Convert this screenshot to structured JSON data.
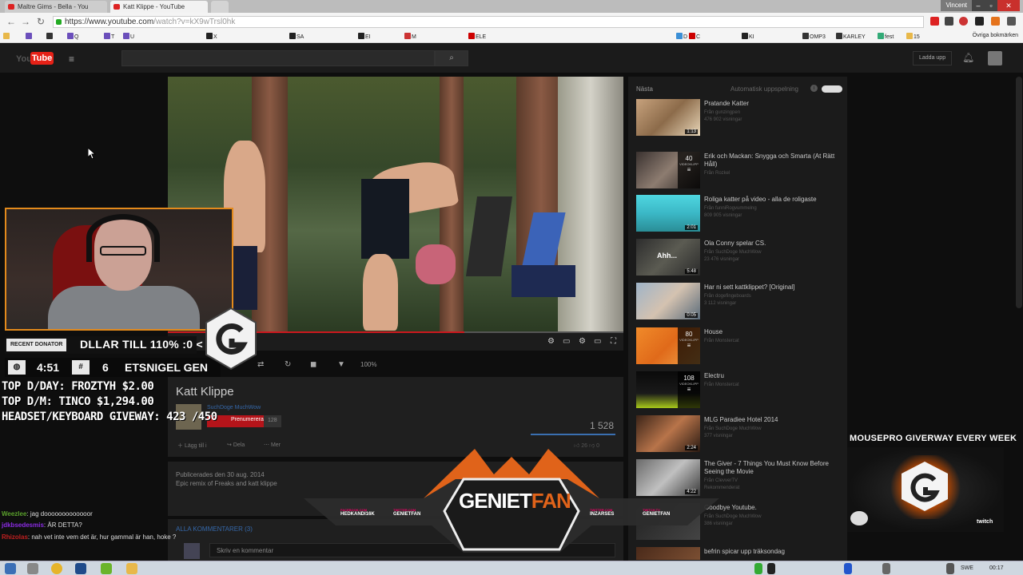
{
  "browser": {
    "tabs": [
      {
        "label": "Maltre Gims - Bella - You"
      },
      {
        "label": "Katt Klippe - YouTube"
      }
    ],
    "user_label": "Vincent",
    "url_host": "https://www.youtube.com",
    "url_rest": "/watch?v=kX9wTrsl0hk",
    "bookmarks": [
      {
        "label": "Q"
      },
      {
        "label": "T"
      },
      {
        "label": "U"
      },
      {
        "label": "X"
      },
      {
        "label": "SA"
      },
      {
        "label": "EI"
      },
      {
        "label": "M"
      },
      {
        "label": "ELE"
      },
      {
        "label": "D"
      },
      {
        "label": "C"
      },
      {
        "label": "KI"
      },
      {
        "label": "OMP3"
      },
      {
        "label": "KARLEY"
      },
      {
        "label": "fest"
      },
      {
        "label": "15"
      }
    ],
    "other_bookmarks": "Övriga bokmärken"
  },
  "youtube": {
    "logo_you": "You",
    "logo_tube": "Tube",
    "upload_label": "Ladda upp",
    "zoom_level": "100%",
    "video_title": "Katt Klippe",
    "channel_name": "SuchDoge MuchWow",
    "subscribe_label": "Prenumerera",
    "sub_count": "128",
    "view_count": "1 528",
    "action_add": "Lägg till i",
    "action_share": "Dela",
    "action_more": "Mer",
    "likes_count": "26",
    "dislikes_count": "0",
    "published": "Publicerades den 30 aug. 2014",
    "description": "Epic remix of Freaks and katt klippe",
    "comments_header": "ALLA KOMMENTARER (3)",
    "comment_placeholder": "Skriv en kommentar"
  },
  "sidebar": {
    "next_label": "Nästa",
    "autoplay_label": "Automatisk uppspelning",
    "items": [
      {
        "title": "Pratande Katter",
        "channel": "Från gunzingpen",
        "views": "476 902 visningar",
        "duration": "1:13",
        "playlist": ""
      },
      {
        "title": "Erik och Mackan: Snygga och Smarta (At Rätt Håll)",
        "channel": "Från Rozkel",
        "views": "",
        "duration": "",
        "playlist": "40"
      },
      {
        "title": "Roliga katter på video - alla de roligaste",
        "channel": "Från funniRogvummelng",
        "views": "809 905 visningar",
        "duration": "2:01",
        "playlist": ""
      },
      {
        "title": "Ola Conny spelar CS.",
        "channel": "Från SuchDoge MuchWow",
        "views": "23 476 visningar",
        "duration": "5:48",
        "playlist": "",
        "overlay": "Ahh..."
      },
      {
        "title": "Har ni sett kattklippet? [Original]",
        "channel": "Från dogefingeboards",
        "views": "3 112 visningar",
        "duration": "0:05",
        "playlist": ""
      },
      {
        "title": "House",
        "channel": "Från Monstercat",
        "views": "",
        "duration": "",
        "playlist": "80"
      },
      {
        "title": "Electru",
        "channel": "Från Monstercat",
        "views": "",
        "duration": "",
        "playlist": "108"
      },
      {
        "title": "MLG Paradiee Hotel 2014",
        "channel": "Från SuchDoge MuchWow",
        "views": "377 visningar",
        "duration": "2:24",
        "playlist": ""
      },
      {
        "title": "The Giver - 7 Things You Must Know Before Seeing the Movie",
        "channel": "Från ClevverTV",
        "views": "Rekommenderat",
        "duration": "4:22",
        "playlist": ""
      },
      {
        "title": "Goodbye Youtube.",
        "channel": "Från SuchDoge MuchWow",
        "views": "386 visningar",
        "duration": "",
        "playlist": ""
      },
      {
        "title": "befrin spicar upp träksondag",
        "channel": "",
        "views": "",
        "duration": "",
        "playlist": ""
      }
    ]
  },
  "overlay": {
    "donator_badge": "RECENT DONATOR",
    "donator_ticker": "DLLAR TILL 110% :0 <",
    "uptime": "4:51",
    "viewers": "6",
    "follower_ticker": "ETSNIGEL GEN",
    "top_lines": [
      "TOP D/DAY: FROZTYH $2.00",
      "TOP D/M: TINCO $1,294.00",
      "HEADSET/KEYBOARD GIVEWAY: 423 /450"
    ],
    "chat": [
      {
        "user": "Weezlee",
        "text": ": jag dooooooooooooor",
        "color": "#5aa02c"
      },
      {
        "user": "jdkbsedesmis",
        "text": ": ÄR DETTA?",
        "color": "#8a2be2"
      },
      {
        "user": "Rhizolas",
        "text": ": nah vet inte vem det är, hur gammal är han, hoke ?",
        "color": "#c02020"
      }
    ],
    "mousepro_text": "MOUSEPRO GIVERWAY EVERY WEEK",
    "twitch_label": "twitch",
    "banner_geniet": "GENIET",
    "banner_fan": "FAN",
    "socials": [
      {
        "network": "FACEBOOK.COM",
        "handle": "HEDKANDI16K"
      },
      {
        "network": "TWITTER.COM",
        "handle": "GENIETFAN"
      },
      {
        "network": "TWITTER.COM",
        "handle": "INZARSES"
      },
      {
        "network": "TWITCH.TV",
        "handle": "GENIETFAN"
      }
    ]
  },
  "taskbar": {
    "lang": "SWE",
    "time": "00:17"
  },
  "colors": {
    "accent_red": "#e62117",
    "overlay_orange": "#e38a1c",
    "link_blue": "#3567a8"
  }
}
